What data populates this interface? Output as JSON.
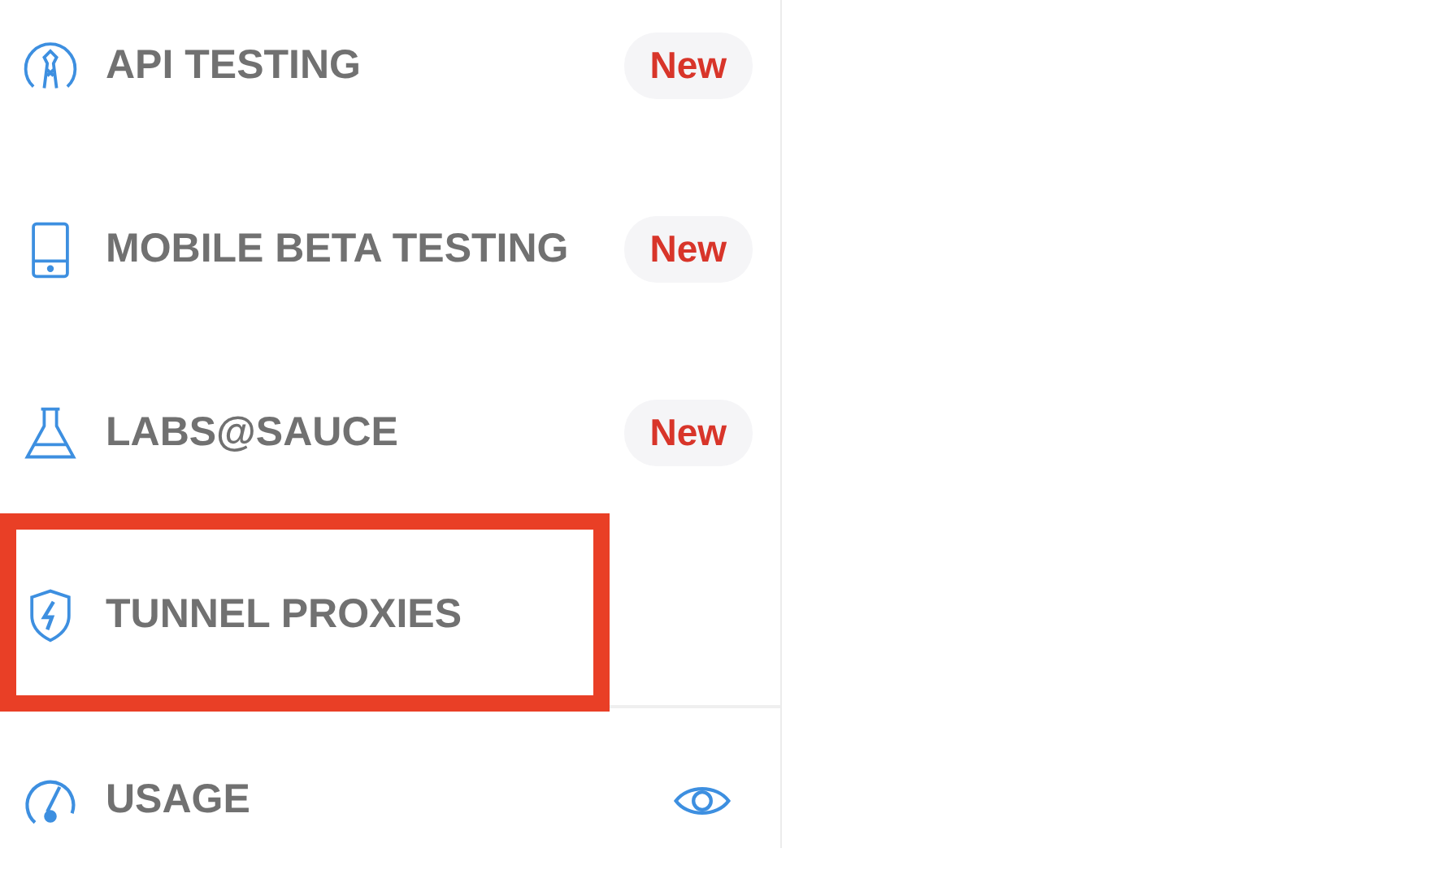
{
  "sidebar": {
    "items": [
      {
        "kind": "badge",
        "label": "API TESTING",
        "badge": "New",
        "highlighted": false,
        "divider_below": false
      },
      {
        "kind": "badge",
        "label": "MOBILE BETA TESTING",
        "badge": "New",
        "highlighted": false,
        "divider_below": false
      },
      {
        "kind": "badge",
        "label": "LABS@SAUCE",
        "badge": "New",
        "highlighted": false,
        "divider_below": false
      },
      {
        "kind": "plain",
        "label": "TUNNEL PROXIES",
        "highlighted": true,
        "divider_below": true
      },
      {
        "kind": "eye",
        "label": "USAGE",
        "highlighted": false,
        "divider_below": false
      }
    ]
  }
}
